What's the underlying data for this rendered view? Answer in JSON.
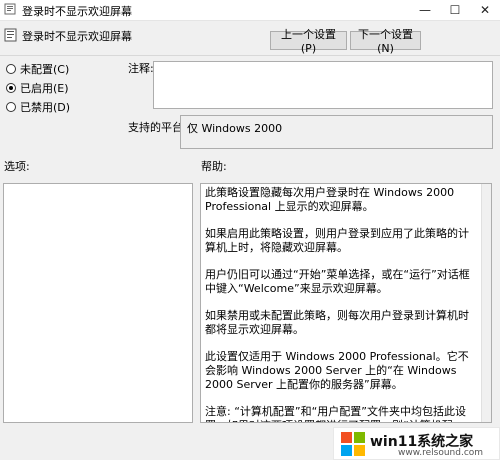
{
  "window": {
    "title": "登录时不显示欢迎屏幕",
    "minimize_icon": "minimize-icon",
    "maximize_icon": "maximize-icon",
    "close_icon": "close-icon"
  },
  "header": {
    "policy_name": "登录时不显示欢迎屏幕",
    "prev_label": "上一个设置(P)",
    "next_label": "下一个设置(N)"
  },
  "state": {
    "options": [
      {
        "label": "未配置(C)",
        "checked": false
      },
      {
        "label": "已启用(E)",
        "checked": true
      },
      {
        "label": "已禁用(D)",
        "checked": false
      }
    ]
  },
  "comment": {
    "label": "注释:",
    "value": ""
  },
  "supported": {
    "label": "支持的平台:",
    "value": "仅 Windows 2000"
  },
  "options_section": {
    "label": "选项:"
  },
  "help": {
    "label": "帮助:",
    "paragraphs": [
      "此策略设置隐藏每次用户登录时在 Windows 2000 Professional 上显示的欢迎屏幕。",
      "如果启用此策略设置，则用户登录到应用了此策略的计算机上时，将隐藏欢迎屏幕。",
      "用户仍旧可以通过“开始”菜单选择，或在“运行”对话框中键入“Welcome”来显示欢迎屏幕。",
      "如果禁用或未配置此策略，则每次用户登录到计算机时都将显示欢迎屏幕。",
      "此设置仅适用于 Windows 2000 Professional。它不会影响 Windows 2000 Server 上的“在 Windows 2000 Server 上配置你的服务器”屏幕。",
      "注意: “计算机配置”和“用户配置”文件夹中均包括此设置。如果对这两项设置都进行了配置，则“计算机配置”中的设置优先于“用户配置”中的设置。"
    ]
  },
  "watermark": {
    "text": "win11系统之家",
    "url": "www.relsound.com",
    "colors": {
      "red": "#f25022",
      "green": "#7fba00",
      "blue": "#00a4ef",
      "yellow": "#ffb900"
    }
  }
}
